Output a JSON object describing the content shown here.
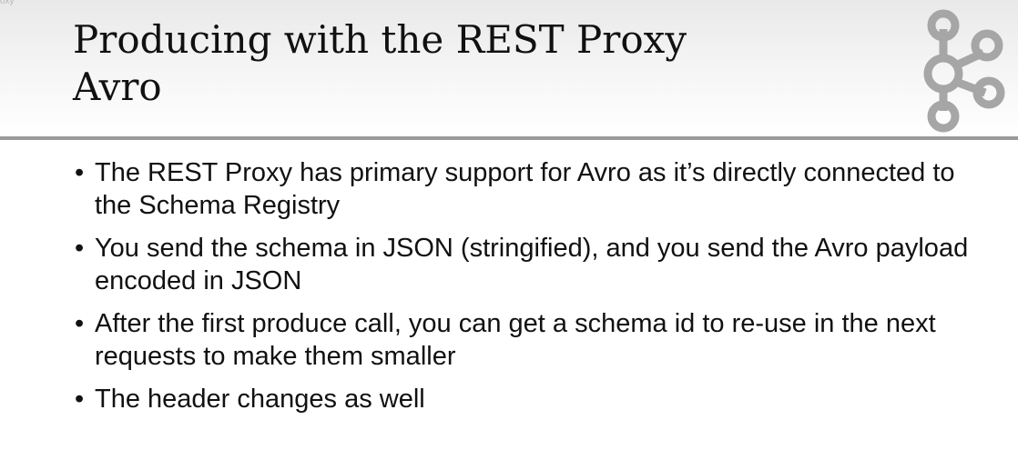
{
  "corner_label": "oxy",
  "slide": {
    "title_line1": "Producing with the REST Proxy",
    "title_line2": "Avro",
    "bullets": [
      "The REST Proxy has primary support for Avro as it’s directly connected to the Schema Registry",
      "You send the schema in JSON (stringified), and you send the Avro payload encoded in JSON",
      "After the first produce call, you can get a schema id to re-use in the next requests to make them smaller",
      "The header changes as well"
    ],
    "bullet_glyph": "•"
  },
  "logo": {
    "icon": "kafka-logo-icon",
    "color": "#a6a6a6"
  },
  "colors": {
    "divider": "#9a9a9a",
    "text": "#111111"
  }
}
